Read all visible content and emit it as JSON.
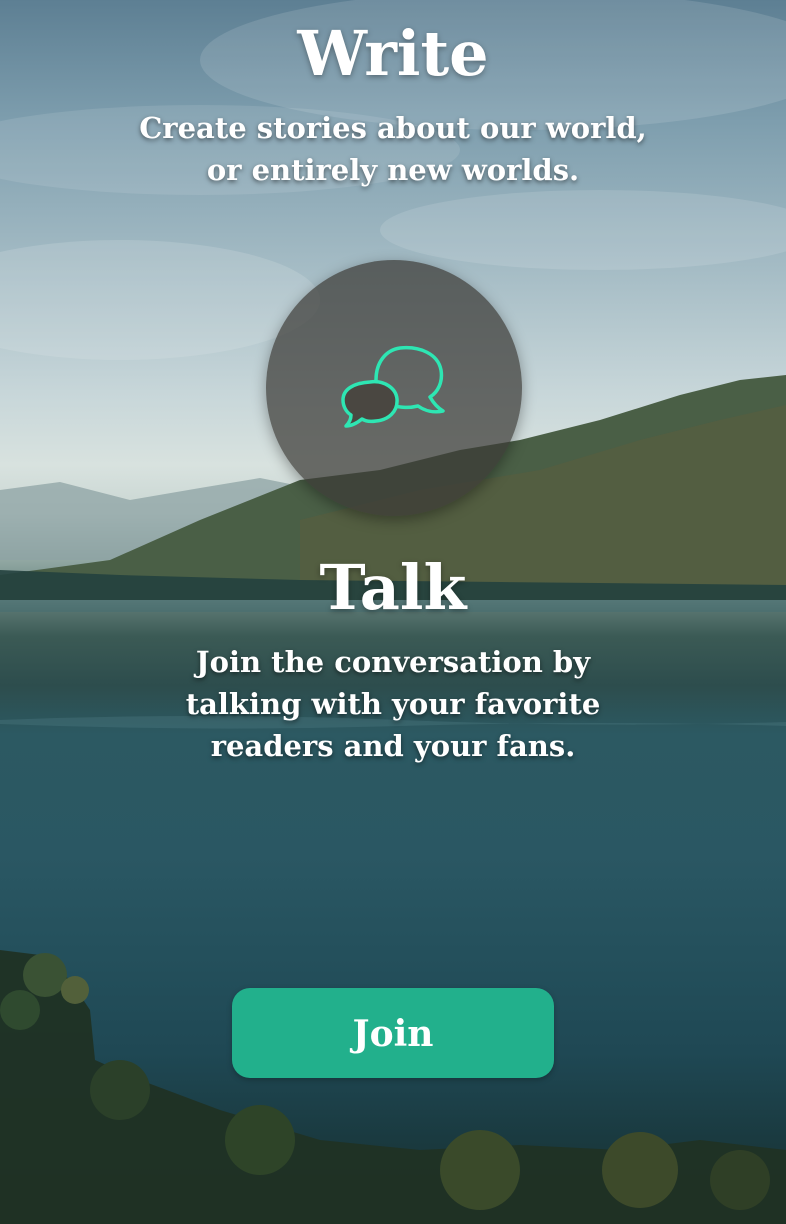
{
  "sections": {
    "write": {
      "title": "Write",
      "description": "Create stories about our world,\nor entirely new worlds."
    },
    "talk": {
      "icon": "speech-bubbles-icon",
      "title": "Talk",
      "description": "Join the conversation by\ntalking with your favorite\nreaders and your fans."
    }
  },
  "join_button": {
    "label": "Join"
  },
  "colors": {
    "accent": "#22b08c",
    "icon_stroke": "#2ee6b3",
    "icon_circle": "#3c3a36"
  }
}
